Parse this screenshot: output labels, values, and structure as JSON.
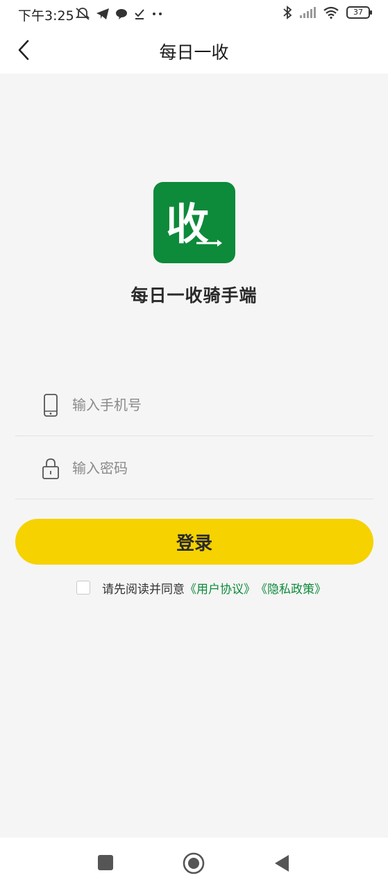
{
  "status_bar": {
    "time": "下午3:25",
    "battery": "37"
  },
  "nav": {
    "title": "每日一收"
  },
  "logo": {
    "mark": "收",
    "mark_prefix": "收"
  },
  "app_name": "每日一收骑手端",
  "form": {
    "phone_placeholder": "输入手机号",
    "password_placeholder": "输入密码",
    "login_label": "登录"
  },
  "agreement": {
    "prefix": "请先阅读并同意",
    "user_agreement": "《用户协议》",
    "privacy_policy": "《隐私政策》"
  },
  "colors": {
    "brand_green": "#0d8a3a",
    "button_yellow": "#f5d200",
    "background": "#f5f5f5"
  }
}
